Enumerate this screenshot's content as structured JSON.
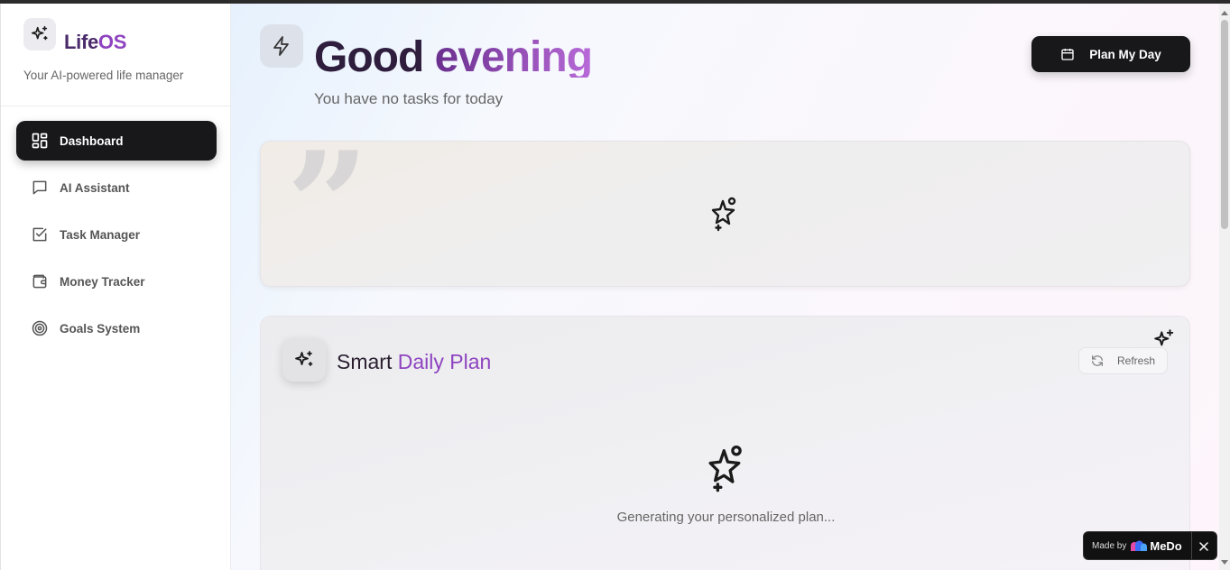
{
  "app": {
    "name_part1": "Life",
    "name_part2": "OS",
    "tagline": "Your AI-powered life manager"
  },
  "sidebar": {
    "items": [
      {
        "label": "Dashboard",
        "icon": "grid-icon",
        "active": true
      },
      {
        "label": "AI Assistant",
        "icon": "chat-icon",
        "active": false
      },
      {
        "label": "Task Manager",
        "icon": "checkbox-icon",
        "active": false
      },
      {
        "label": "Money Tracker",
        "icon": "wallet-icon",
        "active": false
      },
      {
        "label": "Goals System",
        "icon": "target-icon",
        "active": false
      }
    ]
  },
  "header": {
    "greeting_part1": "Good",
    "greeting_part2": "evening",
    "subtitle": "You have no tasks for today",
    "plan_button": "Plan My Day",
    "icon": "lightning-icon"
  },
  "quote_card": {
    "icon": "quote-icon"
  },
  "plan_card": {
    "title_part1": "Smart",
    "title_part2": "Daily Plan",
    "refresh_label": "Refresh",
    "status": "Generating your personalized plan..."
  },
  "badge": {
    "made_by": "Made by",
    "brand": "MeDo"
  },
  "colors": {
    "accent": "#8e44c0",
    "dark": "#18181b"
  }
}
